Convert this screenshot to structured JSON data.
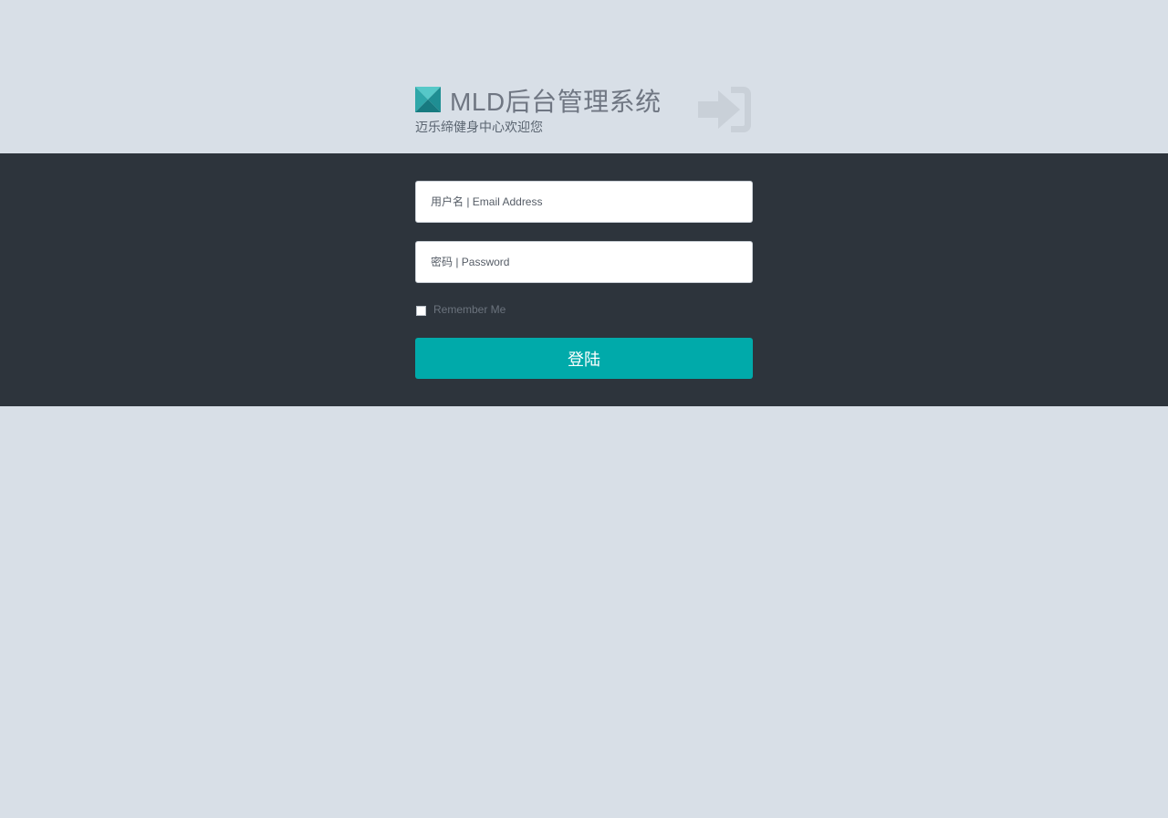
{
  "header": {
    "title": "MLD后台管理系统",
    "subtitle": "迈乐缔健身中心欢迎您",
    "logo_icon": "cube-logo-icon",
    "decor_icon": "sign-in-icon"
  },
  "form": {
    "username_placeholder": "用户名 | Email Address",
    "password_placeholder": "密码 | Password",
    "remember_label": "Remember Me",
    "remember_checked": false,
    "submit_label": "登陆"
  },
  "colors": {
    "background": "#d8dfe7",
    "band": "#2d343c",
    "accent": "#00aaaa"
  }
}
